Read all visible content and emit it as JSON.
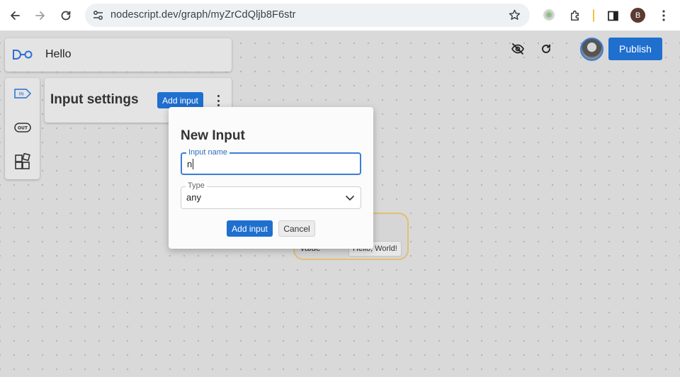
{
  "browser": {
    "url": "nodescript.dev/graph/myZrCdQljb8F6str",
    "profile_initial": "B",
    "icons": {
      "back": "arrow-left-icon",
      "forward": "arrow-right-icon",
      "reload": "reload-icon",
      "site_info": "tune-icon",
      "bookmark": "star-icon",
      "extension": "green-dot-extension-icon",
      "extensions": "puzzle-icon",
      "side_panel": "side-panel-icon",
      "menu": "kebab-vertical-icon"
    }
  },
  "app": {
    "graph_name": "Hello",
    "publish_label": "Publish",
    "top_icons": {
      "visibility": "eye-off-icon",
      "refresh": "refresh-icon"
    },
    "rail": [
      {
        "id": "inputs",
        "icon": "in-tag-icon",
        "label": "IN"
      },
      {
        "id": "output",
        "icon": "out-tag-icon",
        "label": "OUT"
      },
      {
        "id": "modules",
        "icon": "module-grid-icon"
      }
    ],
    "input_settings": {
      "title": "Input settings",
      "add_label": "Add input"
    },
    "node": {
      "port_label": "value",
      "port_value": "Hello, World!"
    }
  },
  "modal": {
    "title": "New Input",
    "name_field": {
      "label": "Input name",
      "value": "n"
    },
    "type_field": {
      "label": "Type",
      "selected": "any"
    },
    "add_label": "Add input",
    "cancel_label": "Cancel"
  },
  "colors": {
    "primary": "#1f6fcf",
    "focus_border": "#3b7dd8",
    "node_border": "#e2bf74",
    "canvas": "#d9d9d9"
  }
}
